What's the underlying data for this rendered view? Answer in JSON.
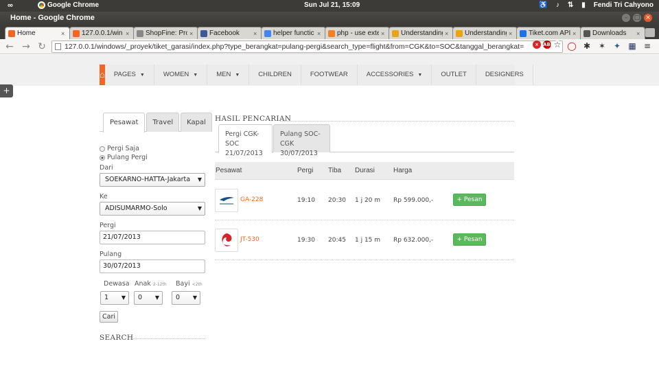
{
  "os": {
    "app_name": "Google Chrome",
    "clock": "Sun Jul 21, 15:09",
    "user": "Fendi Tri Cahyono"
  },
  "window": {
    "title": "Home - Google Chrome"
  },
  "tabs": [
    {
      "label": "Home",
      "favicon_color": "#f26522"
    },
    {
      "label": "127.0.0.1/win",
      "favicon_color": "#f26522"
    },
    {
      "label": "ShopFine: Pro",
      "favicon_color": "#888888"
    },
    {
      "label": "Facebook",
      "favicon_color": "#3b5998"
    },
    {
      "label": "helper functic",
      "favicon_color": "#4285f4"
    },
    {
      "label": "php - use exte",
      "favicon_color": "#f48024"
    },
    {
      "label": "Understanding",
      "favicon_color": "#e8a317"
    },
    {
      "label": "Understanding",
      "favicon_color": "#e8a317"
    },
    {
      "label": "Tiket.com API",
      "favicon_color": "#1a73e8"
    },
    {
      "label": "Downloads",
      "favicon_color": "#555555"
    }
  ],
  "browser": {
    "url": "127.0.0.1/windows/_proyek/tiket_garasi/index.php?type_berangkat=pulang-pergi&search_type=flight&from=CGK&to=SOC&tanggal_berangkat=",
    "ext_abp": "ABP"
  },
  "nav": {
    "items": [
      {
        "label": "PAGES",
        "dropdown": true
      },
      {
        "label": "WOMEN",
        "dropdown": true
      },
      {
        "label": "MEN",
        "dropdown": true
      },
      {
        "label": "CHILDREN",
        "dropdown": false
      },
      {
        "label": "FOOTWEAR",
        "dropdown": false
      },
      {
        "label": "ACCESSORIES",
        "dropdown": true
      },
      {
        "label": "OUTLET",
        "dropdown": false
      },
      {
        "label": "DESIGNERS",
        "dropdown": false
      }
    ],
    "accent": "#f26522"
  },
  "search_form": {
    "tabs": [
      "Pesawat",
      "Travel",
      "Kapal"
    ],
    "trip_one_way": "Pergi Saja",
    "trip_round": "Pulang Pergi",
    "from_label": "Dari",
    "from_value": "SOEKARNO-HATTA-Jakarta",
    "to_label": "Ke",
    "to_value": "ADISUMARMO-Solo",
    "depart_label": "Pergi",
    "depart_value": "21/07/2013",
    "return_label": "Pulang",
    "return_value": "30/07/2013",
    "adult_label": "Dewasa",
    "child_label": "Anak",
    "child_hint": "2-12th",
    "infant_label": "Bayi",
    "infant_hint": "<2th",
    "adult_value": "1",
    "child_value": "0",
    "infant_value": "0",
    "submit": "Cari",
    "search_heading": "SEARCH"
  },
  "results": {
    "heading": "HASIL PENCARIAN",
    "tab_depart_route": "Pergi CGK-SOC",
    "tab_depart_date": "21/07/2013",
    "tab_return_route": "Pulang SOC-CGK",
    "tab_return_date": "30/07/2013",
    "columns": [
      "Pesawat",
      "Pergi",
      "Tiba",
      "Durasi",
      "Harga"
    ],
    "book_label": "+ Pesan",
    "flights": [
      {
        "code": "GA-228",
        "depart": "19:10",
        "arrive": "20:30",
        "duration": "1 j 20 m",
        "price": "Rp 599.000,-",
        "airline_logo": "garuda-logo"
      },
      {
        "code": "JT-530",
        "depart": "19:30",
        "arrive": "20:45",
        "duration": "1 j 15 m",
        "price": "Rp 632.000,-",
        "airline_logo": "lion-air-logo"
      }
    ]
  }
}
